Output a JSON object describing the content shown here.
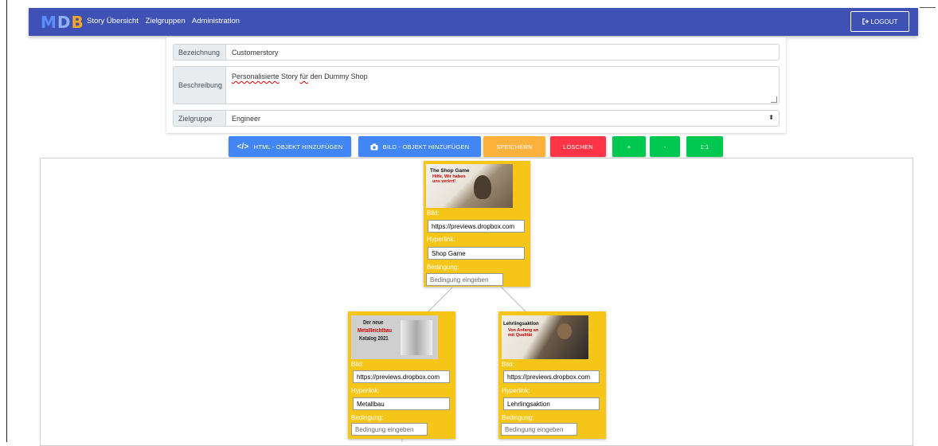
{
  "navbar": {
    "brand": {
      "m": "M",
      "d": "D",
      "b": "B"
    },
    "links": [
      "Story Übersicht",
      "Zielgruppen",
      "Administration"
    ],
    "logout": "LOGOUT"
  },
  "form": {
    "bezeichnung_label": "Bezeichnung",
    "bezeichnung_value": "Customerstory",
    "beschreibung_label": "Beschreibung",
    "beschreibung_word1": "Personalisierte",
    "beschreibung_mid": " Story ",
    "beschreibung_word2": "für",
    "beschreibung_rest": " den Dummy Shop",
    "zielgruppe_label": "Zielgruppe",
    "zielgruppe_value": "Engineer"
  },
  "toolbar": {
    "html_label": "HTML - OBJEKT HINZUFÜGEN",
    "bild_label": "BILD - OBJEKT HINZUFÜGEN",
    "save_label": "SPEICHERN",
    "delete_label": "LÖSCHEN",
    "zoom_in": "+",
    "zoom_out": "-",
    "reset": "1:1"
  },
  "colors": {
    "navbar": "#3f51b5",
    "blue_button": "#4285f4",
    "save": "#fbb13c",
    "delete": "#ff3547",
    "green": "#00c851",
    "node": "#f5c518"
  },
  "nodes": [
    {
      "thumb_title": "The Shop Game",
      "thumb_sub": "Hilfe, Wir haben uns verirrt!",
      "bild_label": "Bild:",
      "bild_value": "https://previews.dropbox.com",
      "hyperlink_label": "Hyperlink:",
      "hyperlink_value": "Shop Game",
      "bedingung_label": "Bedingung:",
      "bedingung_placeholder": "Bedingung eingeben"
    },
    {
      "thumb_title": "Der neue",
      "thumb_sub": "Metallleichtbau",
      "thumb_sub2": "Katalog 2021",
      "bild_label": "Bild:",
      "bild_value": "https://previews.dropbox.com",
      "hyperlink_label": "Hyperlink:",
      "hyperlink_value": "Metallbau",
      "bedingung_label": "Bedingung:",
      "bedingung_placeholder": "Bedingung eingeben"
    },
    {
      "thumb_title": "Lehrlingsaktion",
      "thumb_sub": "Von Anfang an mit Qualität",
      "bild_label": "Bild:",
      "bild_value": "https://previews.dropbox.com",
      "hyperlink_label": "Hyperlink:",
      "hyperlink_value": "Lehrlingsaktion",
      "bedingung_label": "Bedingung:",
      "bedingung_placeholder": "Bedingung eingeben"
    }
  ]
}
